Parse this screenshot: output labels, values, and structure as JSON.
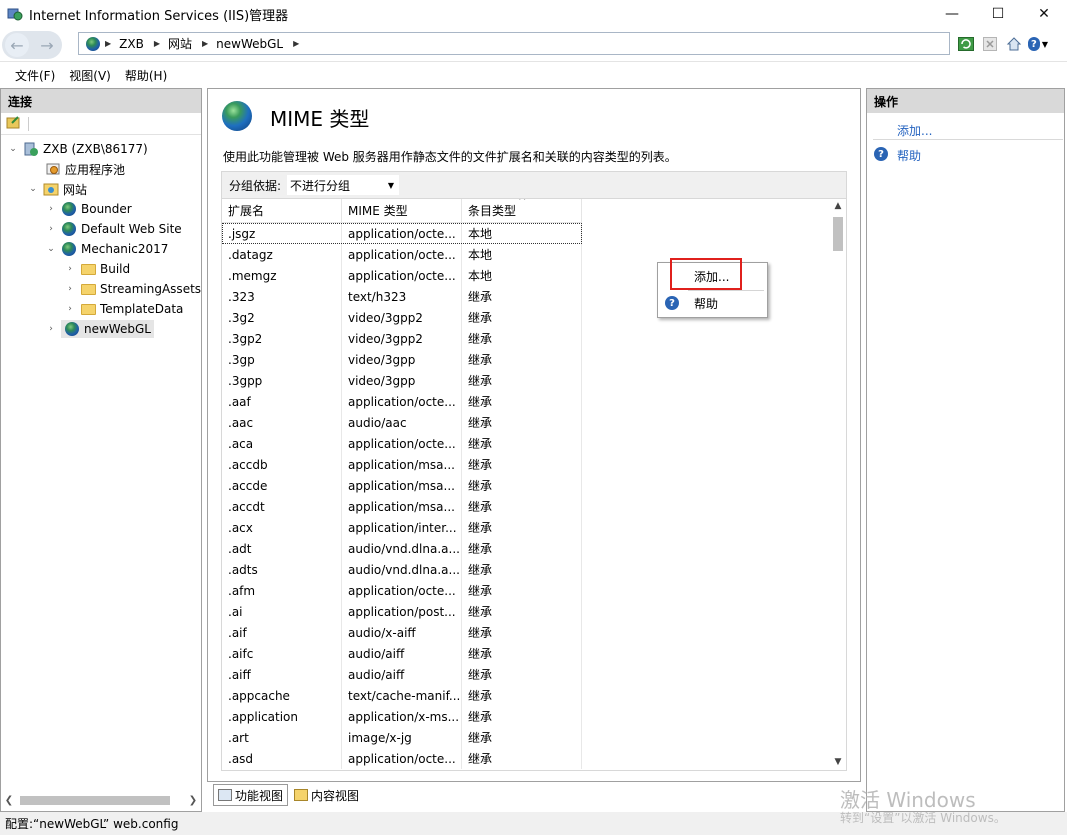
{
  "window": {
    "title": "Internet Information Services (IIS)管理器",
    "minimize": "—",
    "maximize": "☐",
    "close": "✕"
  },
  "address": {
    "crumbs": [
      "ZXB",
      "网站",
      "newWebGL"
    ],
    "back": "←",
    "forward": "→"
  },
  "menu": {
    "items": [
      "文件(F)",
      "视图(V)",
      "帮助(H)"
    ]
  },
  "connections": {
    "header": "连接",
    "tree": [
      {
        "label": "ZXB (ZXB\\86177)",
        "toggle": "⌄"
      },
      {
        "label": "应用程序池",
        "toggle": ""
      },
      {
        "label": "网站",
        "toggle": "⌄"
      },
      {
        "label": "Bounder",
        "toggle": "›"
      },
      {
        "label": "Default Web Site",
        "toggle": "›"
      },
      {
        "label": "Mechanic2017",
        "toggle": "⌄"
      },
      {
        "label": "Build",
        "toggle": "›"
      },
      {
        "label": "StreamingAssets",
        "toggle": "›"
      },
      {
        "label": "TemplateData",
        "toggle": "›"
      },
      {
        "label": "newWebGL",
        "toggle": "›"
      }
    ]
  },
  "feature": {
    "title": "MIME 类型",
    "description": "使用此功能管理被 Web 服务器用作静态文件的文件扩展名和关联的内容类型的列表。",
    "group_label": "分组依据:",
    "group_value": "不进行分组",
    "columns": [
      "扩展名",
      "MIME 类型",
      "条目类型"
    ],
    "rows": [
      [
        ".jsgz",
        "application/octe...",
        "本地"
      ],
      [
        ".datagz",
        "application/octe...",
        "本地"
      ],
      [
        ".memgz",
        "application/octe...",
        "本地"
      ],
      [
        ".323",
        "text/h323",
        "继承"
      ],
      [
        ".3g2",
        "video/3gpp2",
        "继承"
      ],
      [
        ".3gp2",
        "video/3gpp2",
        "继承"
      ],
      [
        ".3gp",
        "video/3gpp",
        "继承"
      ],
      [
        ".3gpp",
        "video/3gpp",
        "继承"
      ],
      [
        ".aaf",
        "application/octe...",
        "继承"
      ],
      [
        ".aac",
        "audio/aac",
        "继承"
      ],
      [
        ".aca",
        "application/octe...",
        "继承"
      ],
      [
        ".accdb",
        "application/msa...",
        "继承"
      ],
      [
        ".accde",
        "application/msa...",
        "继承"
      ],
      [
        ".accdt",
        "application/msa...",
        "继承"
      ],
      [
        ".acx",
        "application/inter...",
        "继承"
      ],
      [
        ".adt",
        "audio/vnd.dlna.a...",
        "继承"
      ],
      [
        ".adts",
        "audio/vnd.dlna.a...",
        "继承"
      ],
      [
        ".afm",
        "application/octe...",
        "继承"
      ],
      [
        ".ai",
        "application/post...",
        "继承"
      ],
      [
        ".aif",
        "audio/x-aiff",
        "继承"
      ],
      [
        ".aifc",
        "audio/aiff",
        "继承"
      ],
      [
        ".aiff",
        "audio/aiff",
        "继承"
      ],
      [
        ".appcache",
        "text/cache-manif...",
        "继承"
      ],
      [
        ".application",
        "application/x-ms...",
        "继承"
      ],
      [
        ".art",
        "image/x-jg",
        "继承"
      ],
      [
        ".asd",
        "application/octe...",
        "继承"
      ]
    ]
  },
  "context_menu": {
    "add": "添加...",
    "help": "帮助"
  },
  "view_tabs": {
    "feature_view": "功能视图",
    "content_view": "内容视图"
  },
  "actions": {
    "header": "操作",
    "add": "添加...",
    "help": "帮助"
  },
  "status": {
    "text": "配置:“newWebGL” web.config"
  },
  "watermark": {
    "title": "激活 Windows",
    "subtitle": "转到“设置”以激活 Windows。"
  },
  "colors": {
    "highlight": "#e0201c",
    "link": "#2664c0"
  }
}
